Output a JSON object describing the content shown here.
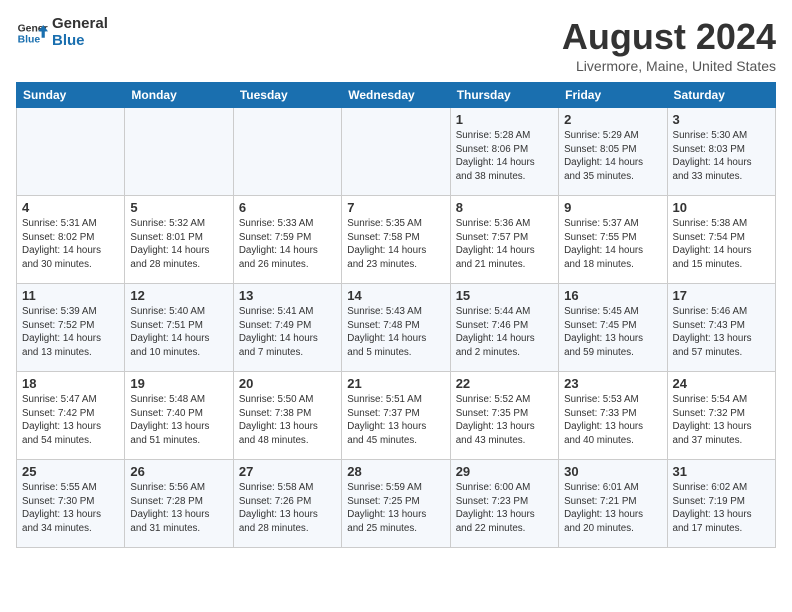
{
  "header": {
    "logo_general": "General",
    "logo_blue": "Blue",
    "month": "August 2024",
    "location": "Livermore, Maine, United States"
  },
  "days_of_week": [
    "Sunday",
    "Monday",
    "Tuesday",
    "Wednesday",
    "Thursday",
    "Friday",
    "Saturday"
  ],
  "weeks": [
    [
      {
        "day": "",
        "info": ""
      },
      {
        "day": "",
        "info": ""
      },
      {
        "day": "",
        "info": ""
      },
      {
        "day": "",
        "info": ""
      },
      {
        "day": "1",
        "info": "Sunrise: 5:28 AM\nSunset: 8:06 PM\nDaylight: 14 hours\nand 38 minutes."
      },
      {
        "day": "2",
        "info": "Sunrise: 5:29 AM\nSunset: 8:05 PM\nDaylight: 14 hours\nand 35 minutes."
      },
      {
        "day": "3",
        "info": "Sunrise: 5:30 AM\nSunset: 8:03 PM\nDaylight: 14 hours\nand 33 minutes."
      }
    ],
    [
      {
        "day": "4",
        "info": "Sunrise: 5:31 AM\nSunset: 8:02 PM\nDaylight: 14 hours\nand 30 minutes."
      },
      {
        "day": "5",
        "info": "Sunrise: 5:32 AM\nSunset: 8:01 PM\nDaylight: 14 hours\nand 28 minutes."
      },
      {
        "day": "6",
        "info": "Sunrise: 5:33 AM\nSunset: 7:59 PM\nDaylight: 14 hours\nand 26 minutes."
      },
      {
        "day": "7",
        "info": "Sunrise: 5:35 AM\nSunset: 7:58 PM\nDaylight: 14 hours\nand 23 minutes."
      },
      {
        "day": "8",
        "info": "Sunrise: 5:36 AM\nSunset: 7:57 PM\nDaylight: 14 hours\nand 21 minutes."
      },
      {
        "day": "9",
        "info": "Sunrise: 5:37 AM\nSunset: 7:55 PM\nDaylight: 14 hours\nand 18 minutes."
      },
      {
        "day": "10",
        "info": "Sunrise: 5:38 AM\nSunset: 7:54 PM\nDaylight: 14 hours\nand 15 minutes."
      }
    ],
    [
      {
        "day": "11",
        "info": "Sunrise: 5:39 AM\nSunset: 7:52 PM\nDaylight: 14 hours\nand 13 minutes."
      },
      {
        "day": "12",
        "info": "Sunrise: 5:40 AM\nSunset: 7:51 PM\nDaylight: 14 hours\nand 10 minutes."
      },
      {
        "day": "13",
        "info": "Sunrise: 5:41 AM\nSunset: 7:49 PM\nDaylight: 14 hours\nand 7 minutes."
      },
      {
        "day": "14",
        "info": "Sunrise: 5:43 AM\nSunset: 7:48 PM\nDaylight: 14 hours\nand 5 minutes."
      },
      {
        "day": "15",
        "info": "Sunrise: 5:44 AM\nSunset: 7:46 PM\nDaylight: 14 hours\nand 2 minutes."
      },
      {
        "day": "16",
        "info": "Sunrise: 5:45 AM\nSunset: 7:45 PM\nDaylight: 13 hours\nand 59 minutes."
      },
      {
        "day": "17",
        "info": "Sunrise: 5:46 AM\nSunset: 7:43 PM\nDaylight: 13 hours\nand 57 minutes."
      }
    ],
    [
      {
        "day": "18",
        "info": "Sunrise: 5:47 AM\nSunset: 7:42 PM\nDaylight: 13 hours\nand 54 minutes."
      },
      {
        "day": "19",
        "info": "Sunrise: 5:48 AM\nSunset: 7:40 PM\nDaylight: 13 hours\nand 51 minutes."
      },
      {
        "day": "20",
        "info": "Sunrise: 5:50 AM\nSunset: 7:38 PM\nDaylight: 13 hours\nand 48 minutes."
      },
      {
        "day": "21",
        "info": "Sunrise: 5:51 AM\nSunset: 7:37 PM\nDaylight: 13 hours\nand 45 minutes."
      },
      {
        "day": "22",
        "info": "Sunrise: 5:52 AM\nSunset: 7:35 PM\nDaylight: 13 hours\nand 43 minutes."
      },
      {
        "day": "23",
        "info": "Sunrise: 5:53 AM\nSunset: 7:33 PM\nDaylight: 13 hours\nand 40 minutes."
      },
      {
        "day": "24",
        "info": "Sunrise: 5:54 AM\nSunset: 7:32 PM\nDaylight: 13 hours\nand 37 minutes."
      }
    ],
    [
      {
        "day": "25",
        "info": "Sunrise: 5:55 AM\nSunset: 7:30 PM\nDaylight: 13 hours\nand 34 minutes."
      },
      {
        "day": "26",
        "info": "Sunrise: 5:56 AM\nSunset: 7:28 PM\nDaylight: 13 hours\nand 31 minutes."
      },
      {
        "day": "27",
        "info": "Sunrise: 5:58 AM\nSunset: 7:26 PM\nDaylight: 13 hours\nand 28 minutes."
      },
      {
        "day": "28",
        "info": "Sunrise: 5:59 AM\nSunset: 7:25 PM\nDaylight: 13 hours\nand 25 minutes."
      },
      {
        "day": "29",
        "info": "Sunrise: 6:00 AM\nSunset: 7:23 PM\nDaylight: 13 hours\nand 22 minutes."
      },
      {
        "day": "30",
        "info": "Sunrise: 6:01 AM\nSunset: 7:21 PM\nDaylight: 13 hours\nand 20 minutes."
      },
      {
        "day": "31",
        "info": "Sunrise: 6:02 AM\nSunset: 7:19 PM\nDaylight: 13 hours\nand 17 minutes."
      }
    ]
  ]
}
